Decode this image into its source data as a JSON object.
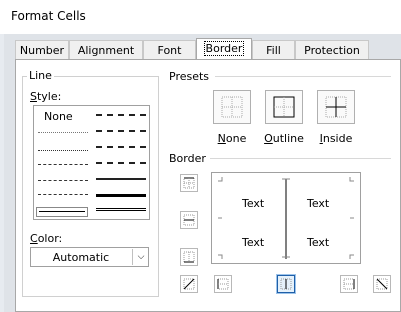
{
  "window": {
    "title": "Format Cells"
  },
  "tabs": [
    {
      "label": "Number"
    },
    {
      "label": "Alignment"
    },
    {
      "label": "Font"
    },
    {
      "label": "Border"
    },
    {
      "label": "Fill"
    },
    {
      "label": "Protection"
    }
  ],
  "line": {
    "group_title": "Line",
    "style_label": "Style:",
    "style_none": "None",
    "color_label": "Color:",
    "color_value": "Automatic"
  },
  "presets": {
    "title": "Presets",
    "items": [
      {
        "label": "None"
      },
      {
        "label": "Outline"
      },
      {
        "label": "Inside"
      }
    ]
  },
  "border": {
    "title": "Border",
    "preview_text": [
      "Text",
      "Text",
      "Text",
      "Text"
    ]
  },
  "colors": {
    "selected_border": "#1f5fa8",
    "panel_bg": "#ffffff"
  }
}
